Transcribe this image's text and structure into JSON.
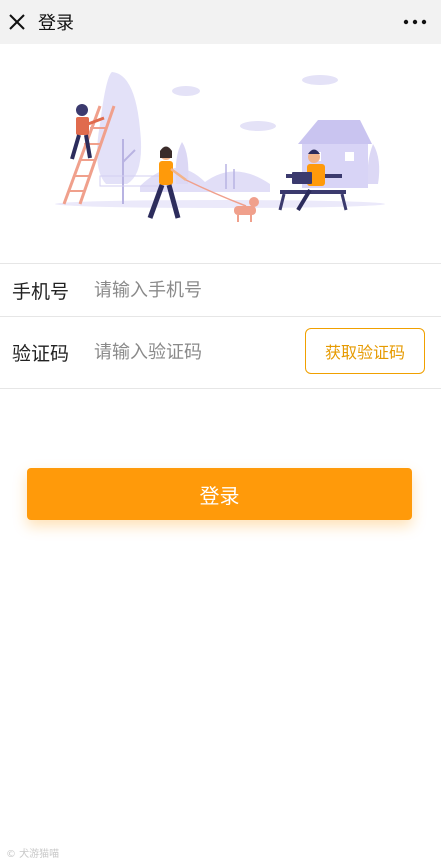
{
  "nav": {
    "title": "登录"
  },
  "form": {
    "phone": {
      "label": "手机号",
      "placeholder": "请输入手机号"
    },
    "code": {
      "label": "验证码",
      "placeholder": "请输入验证码",
      "get_code_label": "获取验证码"
    }
  },
  "login_button": "登录",
  "watermark": "© 犬游猫喵",
  "colors": {
    "accent": "#ff9a0a",
    "nav_bg": "#f2f2f2",
    "illustration": "#c9c4f0"
  },
  "icons": {
    "close": "close-icon",
    "more": "more-icon"
  }
}
